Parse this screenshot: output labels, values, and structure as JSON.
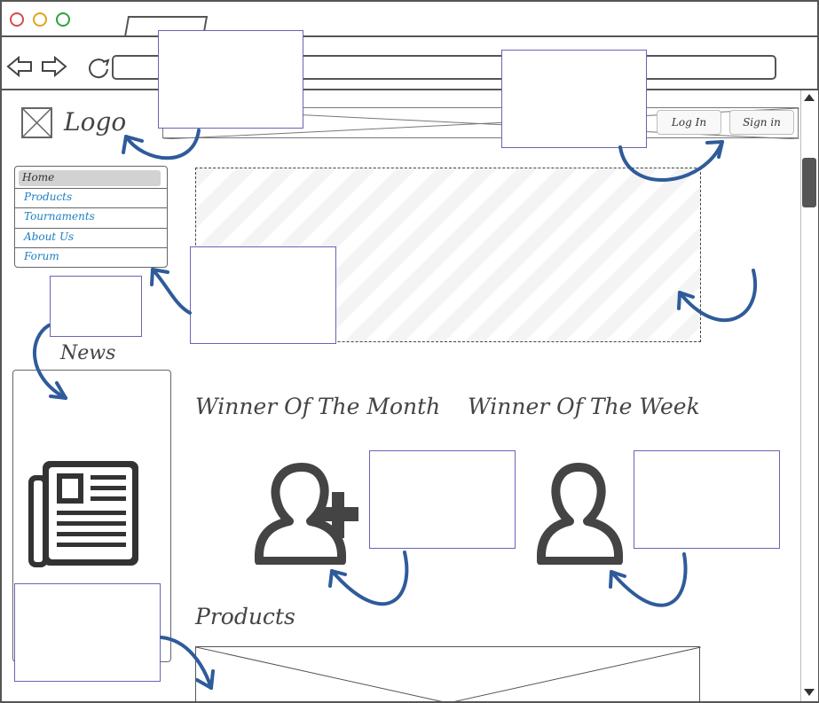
{
  "header": {
    "logo_text": "Logo",
    "login_label": "Log In",
    "signin_label": "Sign in"
  },
  "sidebar": {
    "items": [
      {
        "label": "Home"
      },
      {
        "label": "Products"
      },
      {
        "label": "Tournaments"
      },
      {
        "label": "About Us"
      },
      {
        "label": "Forum"
      }
    ]
  },
  "content": {
    "news_label": "News",
    "winner_month_label": "Winner Of The Month",
    "winner_week_label": "Winner Of The Week",
    "products_label": "Products"
  }
}
